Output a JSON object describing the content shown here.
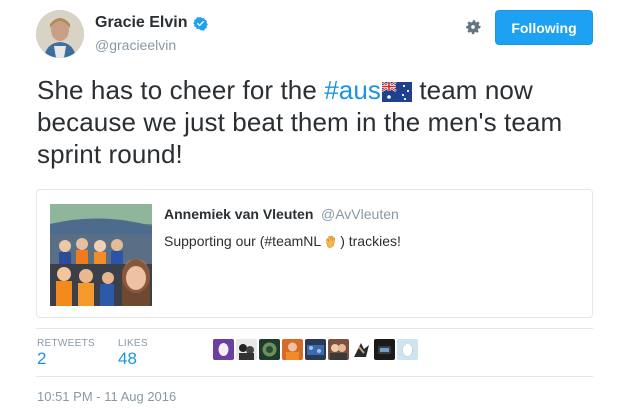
{
  "author": {
    "display_name": "Gracie Elvin",
    "handle": "@gracieelvin",
    "verified": true
  },
  "follow_button": {
    "label": "Following"
  },
  "tweet": {
    "text_before": "She has to cheer for the ",
    "hashtag": "#aus",
    "text_after": " team now because we just beat them in the men's team sprint round!"
  },
  "quoted_tweet": {
    "display_name": "Annemiek van Vleuten",
    "handle": "@AvVleuten",
    "text_before": "Supporting our (#teamNL",
    "text_after": ") trackies!"
  },
  "stats": {
    "retweets_label": "RETWEETS",
    "retweets_value": "2",
    "likes_label": "LIKES",
    "likes_value": "48"
  },
  "timestamp": "10:51 PM - 11 Aug 2016",
  "colors": {
    "accent": "#1da1f2",
    "link": "#1b95e0",
    "muted": "#8899a6",
    "border": "#e1e8ed"
  },
  "icons": [
    "verified-badge-icon",
    "gear-icon",
    "australia-flag-icon",
    "waving-hand-icon"
  ]
}
